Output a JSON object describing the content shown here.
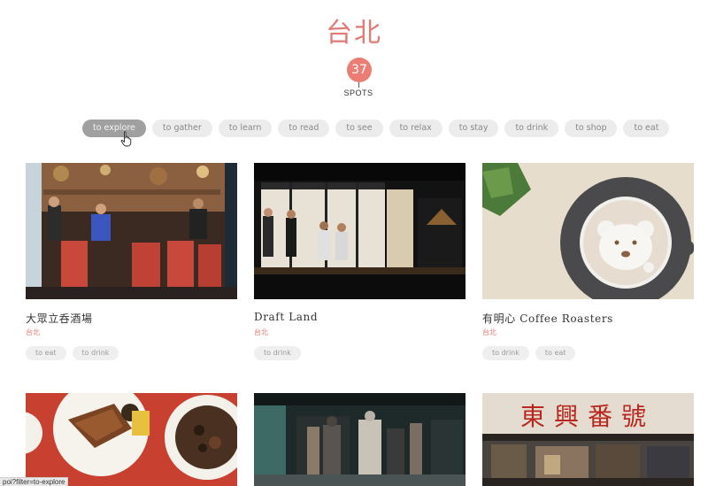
{
  "header": {
    "city": "台北",
    "spot_count": "37",
    "spot_label": "SPOTS"
  },
  "filters": [
    {
      "label": "to explore",
      "active": true
    },
    {
      "label": "to gather",
      "active": false
    },
    {
      "label": "to learn",
      "active": false
    },
    {
      "label": "to read",
      "active": false
    },
    {
      "label": "to see",
      "active": false
    },
    {
      "label": "to relax",
      "active": false
    },
    {
      "label": "to stay",
      "active": false
    },
    {
      "label": "to drink",
      "active": false
    },
    {
      "label": "to shop",
      "active": false
    },
    {
      "label": "to eat",
      "active": false
    }
  ],
  "cards": [
    {
      "name": "大眾立呑酒場",
      "city": "台北",
      "tags": [
        "to eat",
        "to drink"
      ],
      "image": "izakaya-street-photo"
    },
    {
      "name": "Draft Land",
      "city": "台北",
      "tags": [
        "to drink"
      ],
      "image": "cocktail-bar-night-photo"
    },
    {
      "name": "有明心 Coffee Roasters",
      "city": "台北",
      "tags": [
        "to drink",
        "to eat"
      ],
      "image": "latte-art-bear-photo"
    },
    {
      "name": "",
      "city": "",
      "tags": [],
      "image": "braised-pork-dishes-photo"
    },
    {
      "name": "",
      "city": "",
      "tags": [],
      "image": "clothing-shop-interior-photo"
    },
    {
      "name": "",
      "city": "",
      "tags": [],
      "image": "old-storefront-photo"
    }
  ],
  "storefront_sign": "東興番號",
  "status_bar": {
    "url": "poi?filter=to-explore"
  },
  "colors": {
    "accent": "#e07a72",
    "badge": "#ec7d74",
    "pill_bg": "#ececec",
    "pill_active_bg": "#a0a0a0"
  }
}
